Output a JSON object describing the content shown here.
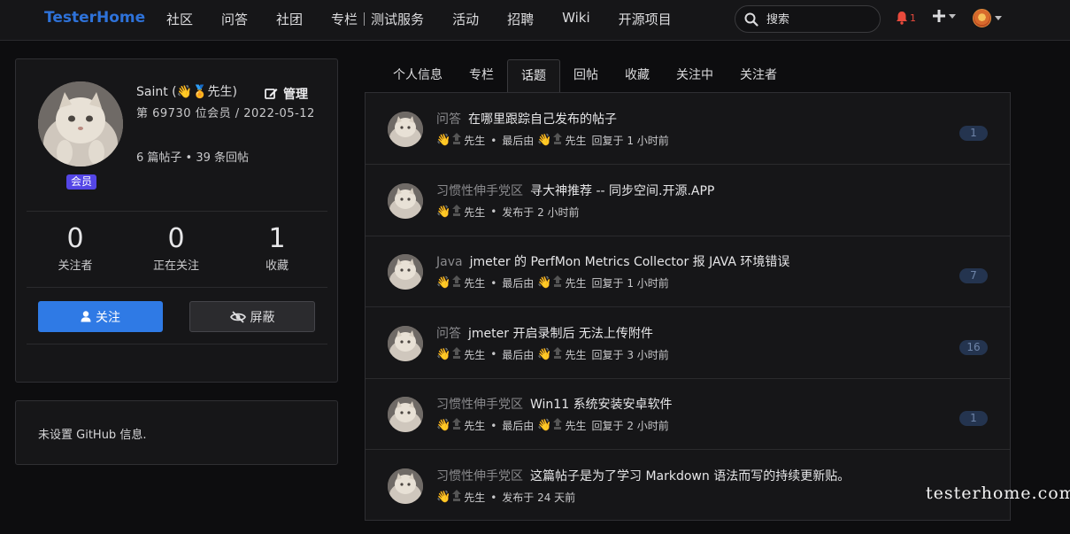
{
  "nav": {
    "brand": "TesterHome",
    "links": [
      "社区",
      "问答",
      "社团",
      "专栏｜测试服务",
      "活动",
      "招聘",
      "Wiki",
      "开源项目"
    ],
    "search_placeholder": "搜索",
    "notify_count": "1"
  },
  "profile": {
    "name": "Saint (👋🏅先生)",
    "manage_label": "管理",
    "member_info": "第 69730 位会员 / 2022-05-12",
    "post_counts": "6 篇帖子 • 39 条回帖",
    "badge": "会员",
    "stats": [
      {
        "num": "0",
        "label": "关注者"
      },
      {
        "num": "0",
        "label": "正在关注"
      },
      {
        "num": "1",
        "label": "收藏"
      }
    ],
    "follow_label": "关注",
    "block_label": "屏蔽"
  },
  "github": {
    "text": "未设置 GitHub 信息."
  },
  "tabs": [
    "个人信息",
    "专栏",
    "话题",
    "回帖",
    "收藏",
    "关注中",
    "关注者"
  ],
  "active_tab": "话题",
  "topics": [
    {
      "node": "问答",
      "title": "在哪里跟踪自己发布的帖子",
      "author": "先生",
      "sep": "•",
      "action": "最后由",
      "last_user": "先生",
      "time": "回复于 1 小时前",
      "count": "1"
    },
    {
      "node": "习惯性伸手党区",
      "title": "寻大神推荐 -- 同步空间.开源.APP",
      "author": "先生",
      "sep": "•",
      "action": "",
      "last_user": "",
      "time": "发布于 2 小时前",
      "count": ""
    },
    {
      "node": "Java",
      "title": "jmeter 的 PerfMon Metrics Collector 报 JAVA 环境错误",
      "author": "先生",
      "sep": "•",
      "action": "最后由",
      "last_user": "先生",
      "time": "回复于 1 小时前",
      "count": "7"
    },
    {
      "node": "问答",
      "title": "jmeter 开启录制后 无法上传附件",
      "author": "先生",
      "sep": "•",
      "action": "最后由",
      "last_user": "先生",
      "time": "回复于 3 小时前",
      "count": "16"
    },
    {
      "node": "习惯性伸手党区",
      "title": "Win11 系统安装安卓软件",
      "author": "先生",
      "sep": "•",
      "action": "最后由",
      "last_user": "先生",
      "time": "回复于 2 小时前",
      "count": "1"
    },
    {
      "node": "习惯性伸手党区",
      "title": "这篇帖子是为了学习 Markdown 语法而写的持续更新贴。",
      "author": "先生",
      "sep": "•",
      "action": "",
      "last_user": "",
      "time": "发布于 24 天前",
      "count": ""
    }
  ],
  "watermark": "testerhome.com",
  "colors": {
    "accent": "#2f7ae5",
    "brand": "#2e72d9",
    "badge": "#5446e6",
    "notify": "#e84a3c"
  }
}
